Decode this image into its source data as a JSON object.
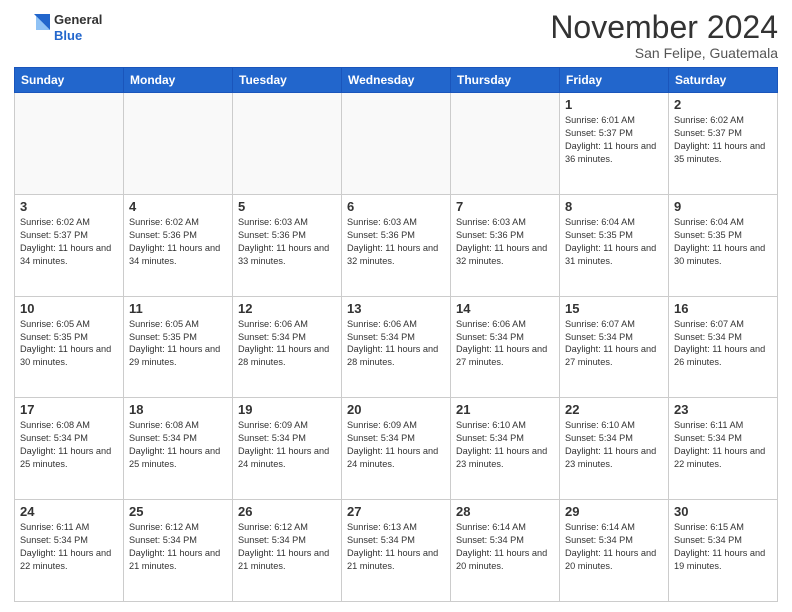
{
  "header": {
    "logo": {
      "line1": "General",
      "line2": "Blue"
    },
    "month": "November 2024",
    "location": "San Felipe, Guatemala"
  },
  "weekdays": [
    "Sunday",
    "Monday",
    "Tuesday",
    "Wednesday",
    "Thursday",
    "Friday",
    "Saturday"
  ],
  "weeks": [
    [
      {
        "day": "",
        "info": ""
      },
      {
        "day": "",
        "info": ""
      },
      {
        "day": "",
        "info": ""
      },
      {
        "day": "",
        "info": ""
      },
      {
        "day": "",
        "info": ""
      },
      {
        "day": "1",
        "info": "Sunrise: 6:01 AM\nSunset: 5:37 PM\nDaylight: 11 hours and 36 minutes."
      },
      {
        "day": "2",
        "info": "Sunrise: 6:02 AM\nSunset: 5:37 PM\nDaylight: 11 hours and 35 minutes."
      }
    ],
    [
      {
        "day": "3",
        "info": "Sunrise: 6:02 AM\nSunset: 5:37 PM\nDaylight: 11 hours and 34 minutes."
      },
      {
        "day": "4",
        "info": "Sunrise: 6:02 AM\nSunset: 5:36 PM\nDaylight: 11 hours and 34 minutes."
      },
      {
        "day": "5",
        "info": "Sunrise: 6:03 AM\nSunset: 5:36 PM\nDaylight: 11 hours and 33 minutes."
      },
      {
        "day": "6",
        "info": "Sunrise: 6:03 AM\nSunset: 5:36 PM\nDaylight: 11 hours and 32 minutes."
      },
      {
        "day": "7",
        "info": "Sunrise: 6:03 AM\nSunset: 5:36 PM\nDaylight: 11 hours and 32 minutes."
      },
      {
        "day": "8",
        "info": "Sunrise: 6:04 AM\nSunset: 5:35 PM\nDaylight: 11 hours and 31 minutes."
      },
      {
        "day": "9",
        "info": "Sunrise: 6:04 AM\nSunset: 5:35 PM\nDaylight: 11 hours and 30 minutes."
      }
    ],
    [
      {
        "day": "10",
        "info": "Sunrise: 6:05 AM\nSunset: 5:35 PM\nDaylight: 11 hours and 30 minutes."
      },
      {
        "day": "11",
        "info": "Sunrise: 6:05 AM\nSunset: 5:35 PM\nDaylight: 11 hours and 29 minutes."
      },
      {
        "day": "12",
        "info": "Sunrise: 6:06 AM\nSunset: 5:34 PM\nDaylight: 11 hours and 28 minutes."
      },
      {
        "day": "13",
        "info": "Sunrise: 6:06 AM\nSunset: 5:34 PM\nDaylight: 11 hours and 28 minutes."
      },
      {
        "day": "14",
        "info": "Sunrise: 6:06 AM\nSunset: 5:34 PM\nDaylight: 11 hours and 27 minutes."
      },
      {
        "day": "15",
        "info": "Sunrise: 6:07 AM\nSunset: 5:34 PM\nDaylight: 11 hours and 27 minutes."
      },
      {
        "day": "16",
        "info": "Sunrise: 6:07 AM\nSunset: 5:34 PM\nDaylight: 11 hours and 26 minutes."
      }
    ],
    [
      {
        "day": "17",
        "info": "Sunrise: 6:08 AM\nSunset: 5:34 PM\nDaylight: 11 hours and 25 minutes."
      },
      {
        "day": "18",
        "info": "Sunrise: 6:08 AM\nSunset: 5:34 PM\nDaylight: 11 hours and 25 minutes."
      },
      {
        "day": "19",
        "info": "Sunrise: 6:09 AM\nSunset: 5:34 PM\nDaylight: 11 hours and 24 minutes."
      },
      {
        "day": "20",
        "info": "Sunrise: 6:09 AM\nSunset: 5:34 PM\nDaylight: 11 hours and 24 minutes."
      },
      {
        "day": "21",
        "info": "Sunrise: 6:10 AM\nSunset: 5:34 PM\nDaylight: 11 hours and 23 minutes."
      },
      {
        "day": "22",
        "info": "Sunrise: 6:10 AM\nSunset: 5:34 PM\nDaylight: 11 hours and 23 minutes."
      },
      {
        "day": "23",
        "info": "Sunrise: 6:11 AM\nSunset: 5:34 PM\nDaylight: 11 hours and 22 minutes."
      }
    ],
    [
      {
        "day": "24",
        "info": "Sunrise: 6:11 AM\nSunset: 5:34 PM\nDaylight: 11 hours and 22 minutes."
      },
      {
        "day": "25",
        "info": "Sunrise: 6:12 AM\nSunset: 5:34 PM\nDaylight: 11 hours and 21 minutes."
      },
      {
        "day": "26",
        "info": "Sunrise: 6:12 AM\nSunset: 5:34 PM\nDaylight: 11 hours and 21 minutes."
      },
      {
        "day": "27",
        "info": "Sunrise: 6:13 AM\nSunset: 5:34 PM\nDaylight: 11 hours and 21 minutes."
      },
      {
        "day": "28",
        "info": "Sunrise: 6:14 AM\nSunset: 5:34 PM\nDaylight: 11 hours and 20 minutes."
      },
      {
        "day": "29",
        "info": "Sunrise: 6:14 AM\nSunset: 5:34 PM\nDaylight: 11 hours and 20 minutes."
      },
      {
        "day": "30",
        "info": "Sunrise: 6:15 AM\nSunset: 5:34 PM\nDaylight: 11 hours and 19 minutes."
      }
    ]
  ]
}
